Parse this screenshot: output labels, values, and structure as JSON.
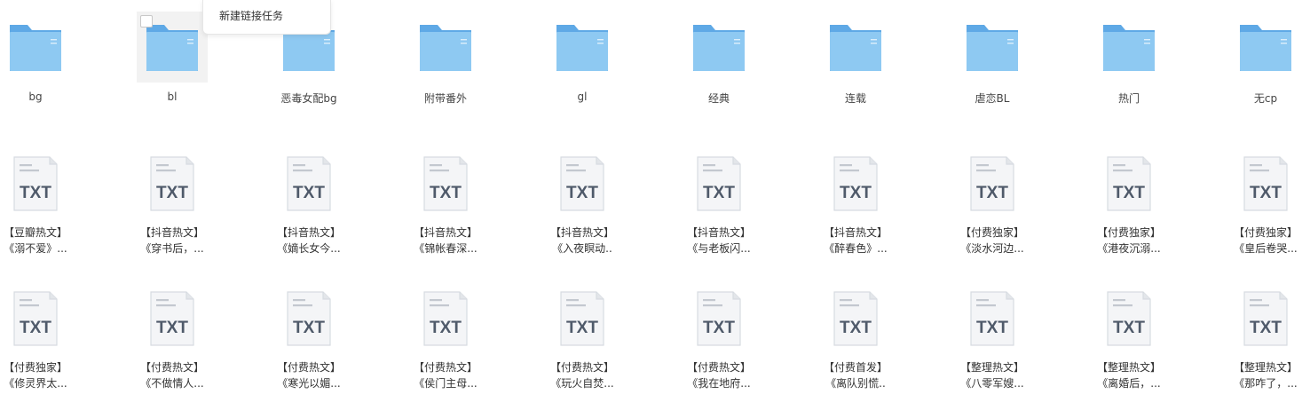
{
  "context_menu": {
    "new_link_task": "新建链接任务"
  },
  "colors": {
    "folder_body": "#8ec9f2",
    "folder_back": "#5fa9e6",
    "txt_paper": "#f4f5f7",
    "txt_text": "#4f5a6a"
  },
  "folders": [
    {
      "name": "bg",
      "icon": "folder-icon"
    },
    {
      "name": "bl",
      "icon": "folder-icon",
      "selected": true
    },
    {
      "name": "恶毒女配bg",
      "icon": "folder-icon"
    },
    {
      "name": "附带番外",
      "icon": "folder-icon"
    },
    {
      "name": "gl",
      "icon": "folder-icon"
    },
    {
      "name": "经典",
      "icon": "folder-icon"
    },
    {
      "name": "连载",
      "icon": "folder-icon"
    },
    {
      "name": "虐恋BL",
      "icon": "folder-icon"
    },
    {
      "name": "热门",
      "icon": "folder-icon"
    },
    {
      "name": "无cp",
      "icon": "folder-icon"
    }
  ],
  "files_row1": [
    {
      "icon_label": "TXT",
      "tag": "【豆瓣热文】",
      "title": "《溺不爱》..."
    },
    {
      "icon_label": "TXT",
      "tag": "【抖音热文】",
      "title": "《穿书后，..."
    },
    {
      "icon_label": "TXT",
      "tag": "【抖音热文】",
      "title": "《嫡长女今..."
    },
    {
      "icon_label": "TXT",
      "tag": "【抖音热文】",
      "title": "《锦帐春深..."
    },
    {
      "icon_label": "TXT",
      "tag": "【抖音热文】",
      "title": "《入夜瞑动.."
    },
    {
      "icon_label": "TXT",
      "tag": "【抖音热文】",
      "title": "《与老板闪..."
    },
    {
      "icon_label": "TXT",
      "tag": "【抖音热文】",
      "title": "《醉春色》..."
    },
    {
      "icon_label": "TXT",
      "tag": "【付费独家】",
      "title": "《淡水河边..."
    },
    {
      "icon_label": "TXT",
      "tag": "【付费独家】",
      "title": "《港夜沉溺..."
    },
    {
      "icon_label": "TXT",
      "tag": "【付费独家】",
      "title": "《皇后卷哭..."
    }
  ],
  "files_row2": [
    {
      "icon_label": "TXT",
      "tag": "【付费独家】",
      "title": "《修灵界太..."
    },
    {
      "icon_label": "TXT",
      "tag": "【付费热文】",
      "title": "《不做情人..."
    },
    {
      "icon_label": "TXT",
      "tag": "【付费热文】",
      "title": "《寒光以媚..."
    },
    {
      "icon_label": "TXT",
      "tag": "【付费热文】",
      "title": "《侯门主母..."
    },
    {
      "icon_label": "TXT",
      "tag": "【付费热文】",
      "title": "《玩火自焚..."
    },
    {
      "icon_label": "TXT",
      "tag": "【付费热文】",
      "title": "《我在地府..."
    },
    {
      "icon_label": "TXT",
      "tag": "【付费首发】",
      "title": "《离队别慌.."
    },
    {
      "icon_label": "TXT",
      "tag": "【整理热文】",
      "title": "《八零军嫂..."
    },
    {
      "icon_label": "TXT",
      "tag": "【整理热文】",
      "title": "《离婚后，..."
    },
    {
      "icon_label": "TXT",
      "tag": "【整理热文】",
      "title": "《那咋了，..."
    }
  ]
}
